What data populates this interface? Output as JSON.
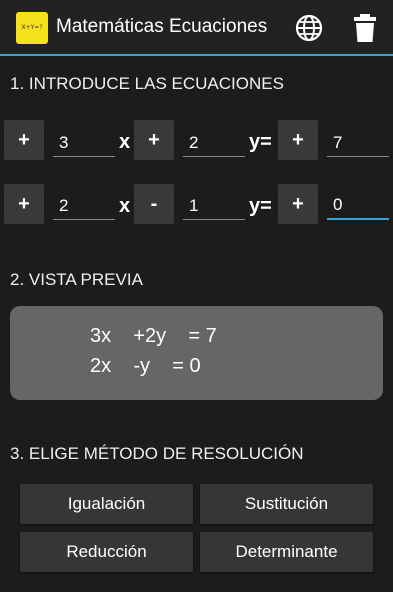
{
  "app": {
    "title": "Matemáticas Ecuaciones",
    "logo_text": "X+Y=?",
    "icons": {
      "language": "globe-icon",
      "delete": "trash-icon"
    },
    "accent_color": "#2fa8d8"
  },
  "section1": {
    "title": "1. INTRODUCE LAS ECUACIONES",
    "rows": [
      {
        "x_sign": "+",
        "x_value": "3",
        "x_label": "x",
        "y_sign": "+",
        "y_value": "2",
        "y_label": "y=",
        "r_sign": "+",
        "r_value": "7"
      },
      {
        "x_sign": "+",
        "x_value": "2",
        "x_label": "x",
        "y_sign": "-",
        "y_value": "1",
        "y_label": "y=",
        "r_sign": "+",
        "r_value": "0"
      }
    ]
  },
  "section2": {
    "title": "2. VISTA PREVIA",
    "lines": [
      "3x    +2y    = 7",
      "2x    -y    = 0"
    ]
  },
  "section3": {
    "title": "3. ELIGE MÉTODO DE RESOLUCIÓN",
    "methods": [
      "Igualación",
      "Sustitución",
      "Reducción",
      "Determinante"
    ]
  }
}
